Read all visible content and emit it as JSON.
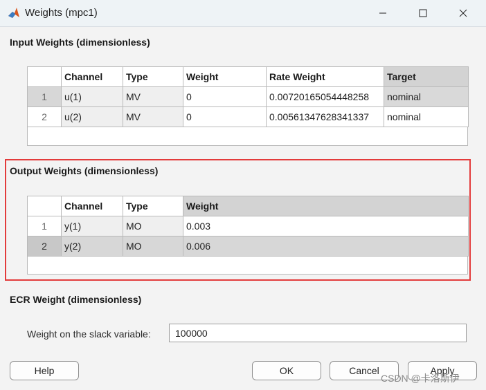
{
  "window": {
    "title": "Weights (mpc1)",
    "icons": [
      "matlab-icon",
      "minimize-icon",
      "maximize-icon",
      "close-icon"
    ]
  },
  "input_weights": {
    "title": "Input Weights (dimensionless)",
    "columns": [
      "",
      "Channel",
      "Type",
      "Weight",
      "Rate Weight",
      "Target"
    ],
    "rows": [
      {
        "num": "1",
        "channel": "u(1)",
        "type": "MV",
        "weight": "0",
        "rate_weight": "0.00720165054448258",
        "target": "nominal"
      },
      {
        "num": "2",
        "channel": "u(2)",
        "type": "MV",
        "weight": "0",
        "rate_weight": "0.00561347628341337",
        "target": "nominal"
      }
    ]
  },
  "output_weights": {
    "title": "Output Weights (dimensionless)",
    "columns": [
      "",
      "Channel",
      "Type",
      "Weight"
    ],
    "rows": [
      {
        "num": "1",
        "channel": "y(1)",
        "type": "MO",
        "weight": "0.003"
      },
      {
        "num": "2",
        "channel": "y(2)",
        "type": "MO",
        "weight": "0.006"
      }
    ]
  },
  "ecr_weight": {
    "title": "ECR Weight (dimensionless)",
    "slack_label": "Weight on the slack variable:",
    "slack_value": "100000"
  },
  "buttons": {
    "help": "Help",
    "ok": "OK",
    "cancel": "Cancel",
    "apply": "Apply"
  },
  "watermark": "CSDN @卡洛斯伊",
  "colors": {
    "highlight_border": "#e33b3b",
    "selected_row": "#d7d7d7",
    "readonly_cell": "#efefef"
  }
}
